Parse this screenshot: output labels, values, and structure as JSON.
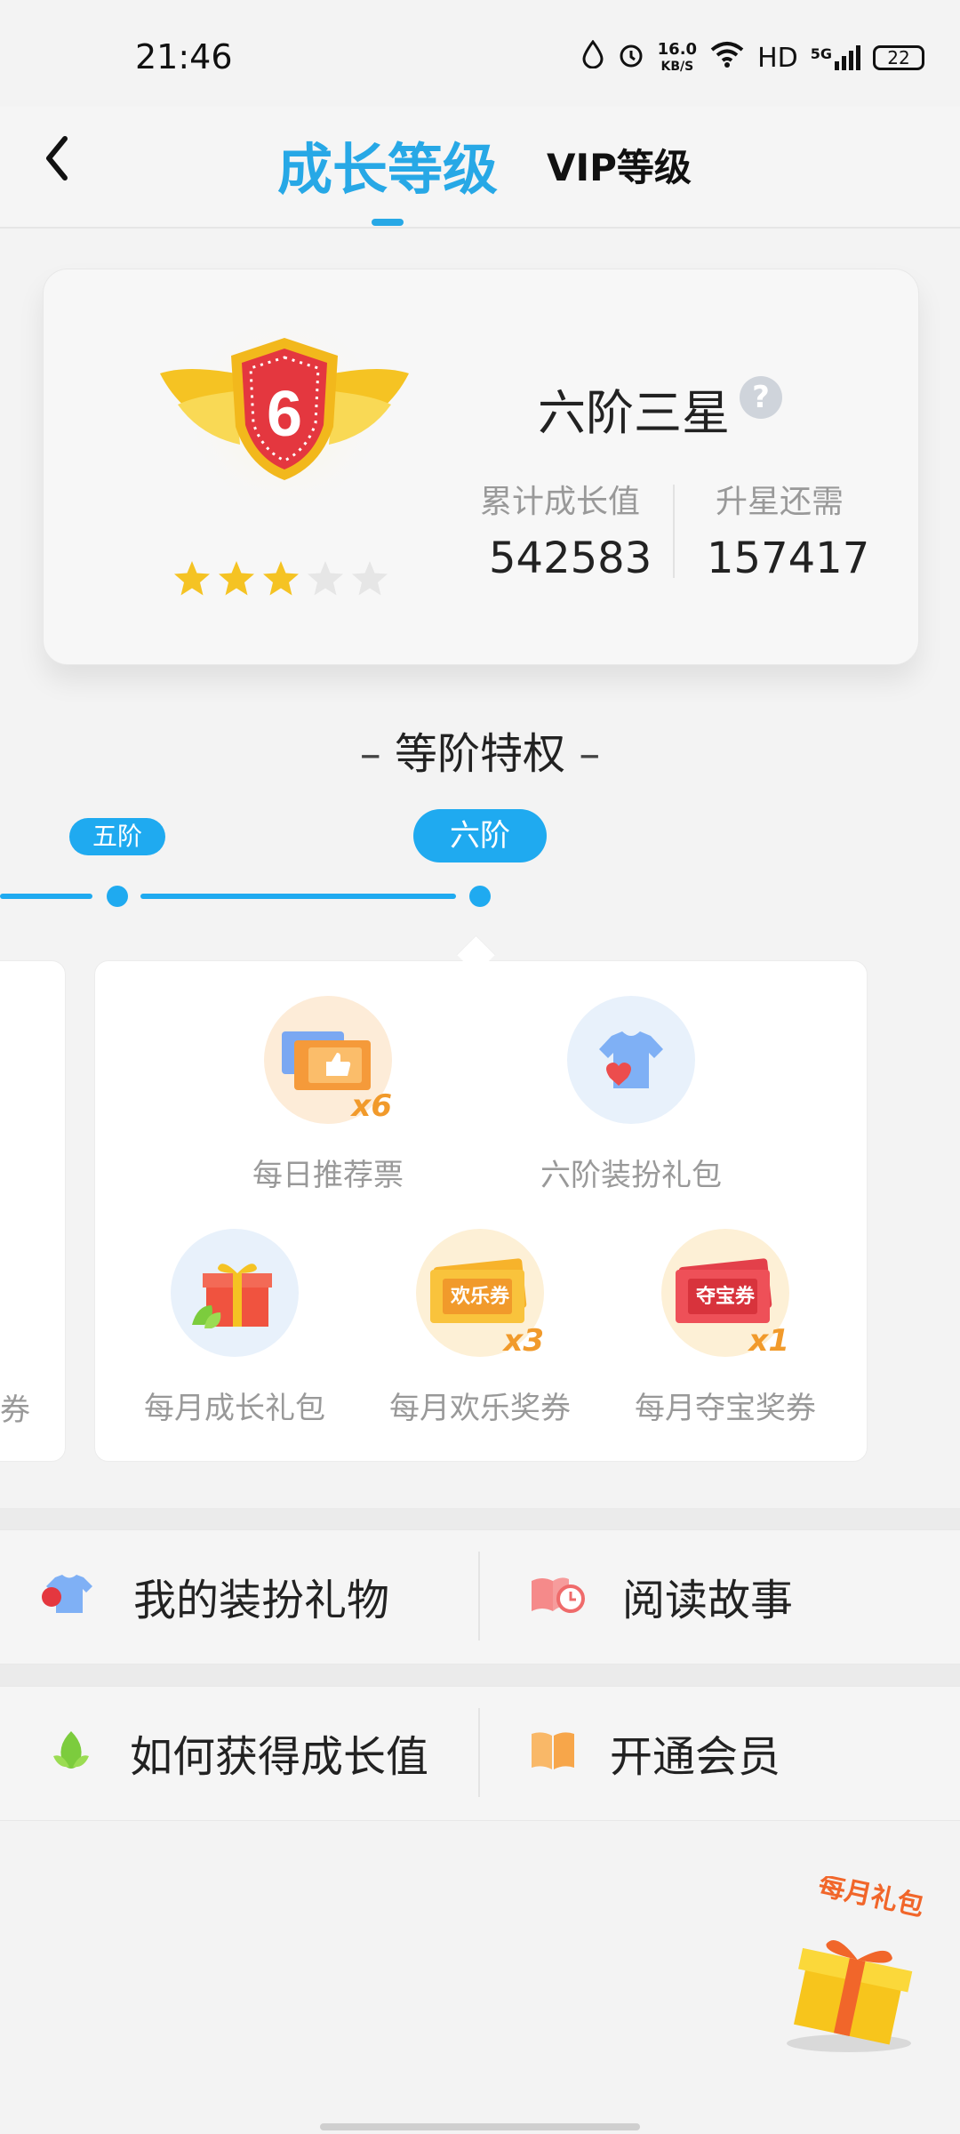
{
  "status_bar": {
    "time": "21:46",
    "speed_value": "16.0",
    "speed_unit": "KB/S",
    "hd": "HD",
    "network": "5G",
    "battery": "22"
  },
  "header": {
    "tab_growth": "成长等级",
    "tab_vip": "VIP等级"
  },
  "level_card": {
    "level_name": "六阶三星",
    "help": "?",
    "badge_number": "6",
    "stars_filled": 3,
    "stars_total": 5,
    "accumulated_label": "累计成长值",
    "accumulated_value": "542583",
    "needed_label": "升星还需",
    "needed_value": "157417"
  },
  "privileges": {
    "title": "等阶特权",
    "tiers": [
      "五阶",
      "六阶"
    ],
    "items": [
      {
        "label": "每日推荐票",
        "mult": "x6"
      },
      {
        "label": "六阶装扮礼包",
        "mult": ""
      },
      {
        "label": "每月成长礼包",
        "mult": ""
      },
      {
        "label": "每月欢乐奖券",
        "mult": "x3",
        "ticket": "欢乐券"
      },
      {
        "label": "每月夺宝奖券",
        "mult": "x1",
        "ticket": "夺宝券"
      }
    ],
    "left_panel_fragment": "券"
  },
  "menu": [
    {
      "label": "我的装扮礼物"
    },
    {
      "label": "阅读故事"
    },
    {
      "label": "如何获得成长值"
    },
    {
      "label": "开通会员"
    }
  ],
  "floating": {
    "label": "每月礼包"
  },
  "colors": {
    "accent": "#27a8e6",
    "timeline": "#1faaf0",
    "gold": "#f5c323",
    "shield_red": "#e4373f"
  }
}
